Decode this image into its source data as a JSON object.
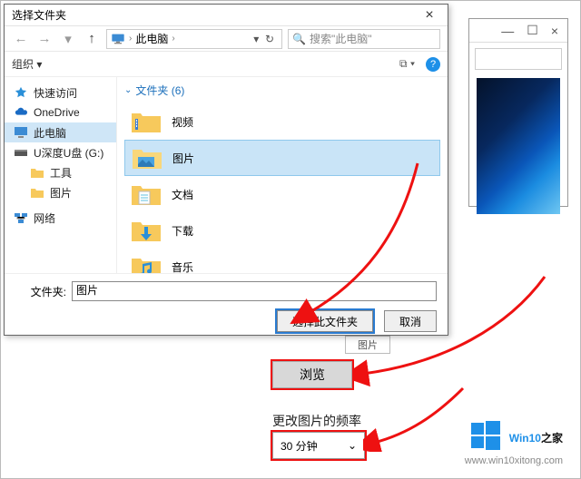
{
  "dialog": {
    "title": "选择文件夹",
    "close_glyph": "×",
    "nav": {
      "back_glyph": "←",
      "fwd_glyph": "→",
      "up_glyph": "↑",
      "location": "此电脑",
      "sep_glyph": "›",
      "refresh_glyph": "↻",
      "dropdown_glyph": "▾"
    },
    "search": {
      "placeholder": "搜索\"此电脑\"",
      "icon_glyph": "🔍"
    },
    "toolbar": {
      "organize": "组织 ▾",
      "view_glyph": "⧉ ▾",
      "help_glyph": "?"
    },
    "sidebar": {
      "items": [
        {
          "label": "快速访问",
          "kind": "quick"
        },
        {
          "label": "OneDrive",
          "kind": "onedrive"
        },
        {
          "label": "此电脑",
          "kind": "pc",
          "selected": true
        },
        {
          "label": "U深度U盘 (G:)",
          "kind": "usb"
        },
        {
          "label": "工具",
          "kind": "folder",
          "sub": true
        },
        {
          "label": "图片",
          "kind": "folder",
          "sub": true
        },
        {
          "label": "网络",
          "kind": "network"
        }
      ]
    },
    "section": {
      "header": "文件夹 (6)"
    },
    "items": [
      {
        "label": "视频",
        "kind": "video"
      },
      {
        "label": "图片",
        "kind": "pictures",
        "selected": true
      },
      {
        "label": "文档",
        "kind": "docs"
      },
      {
        "label": "下载",
        "kind": "downloads"
      },
      {
        "label": "音乐",
        "kind": "music"
      }
    ],
    "footer": {
      "label": "文件夹:",
      "value": "图片",
      "select_btn": "选择此文件夹",
      "cancel_btn": "取消"
    }
  },
  "settings": {
    "badge": "图片",
    "browse_btn": "浏览",
    "freq_label": "更改图片的频率",
    "freq_value": "30 分钟",
    "freq_caret": "⌄"
  },
  "bgwin": {
    "min_glyph": "—",
    "max_glyph": "☐",
    "close_glyph": "×"
  },
  "brand": {
    "text_a": "Win10",
    "text_b": "之家",
    "url": "www.win10xitong.com"
  }
}
